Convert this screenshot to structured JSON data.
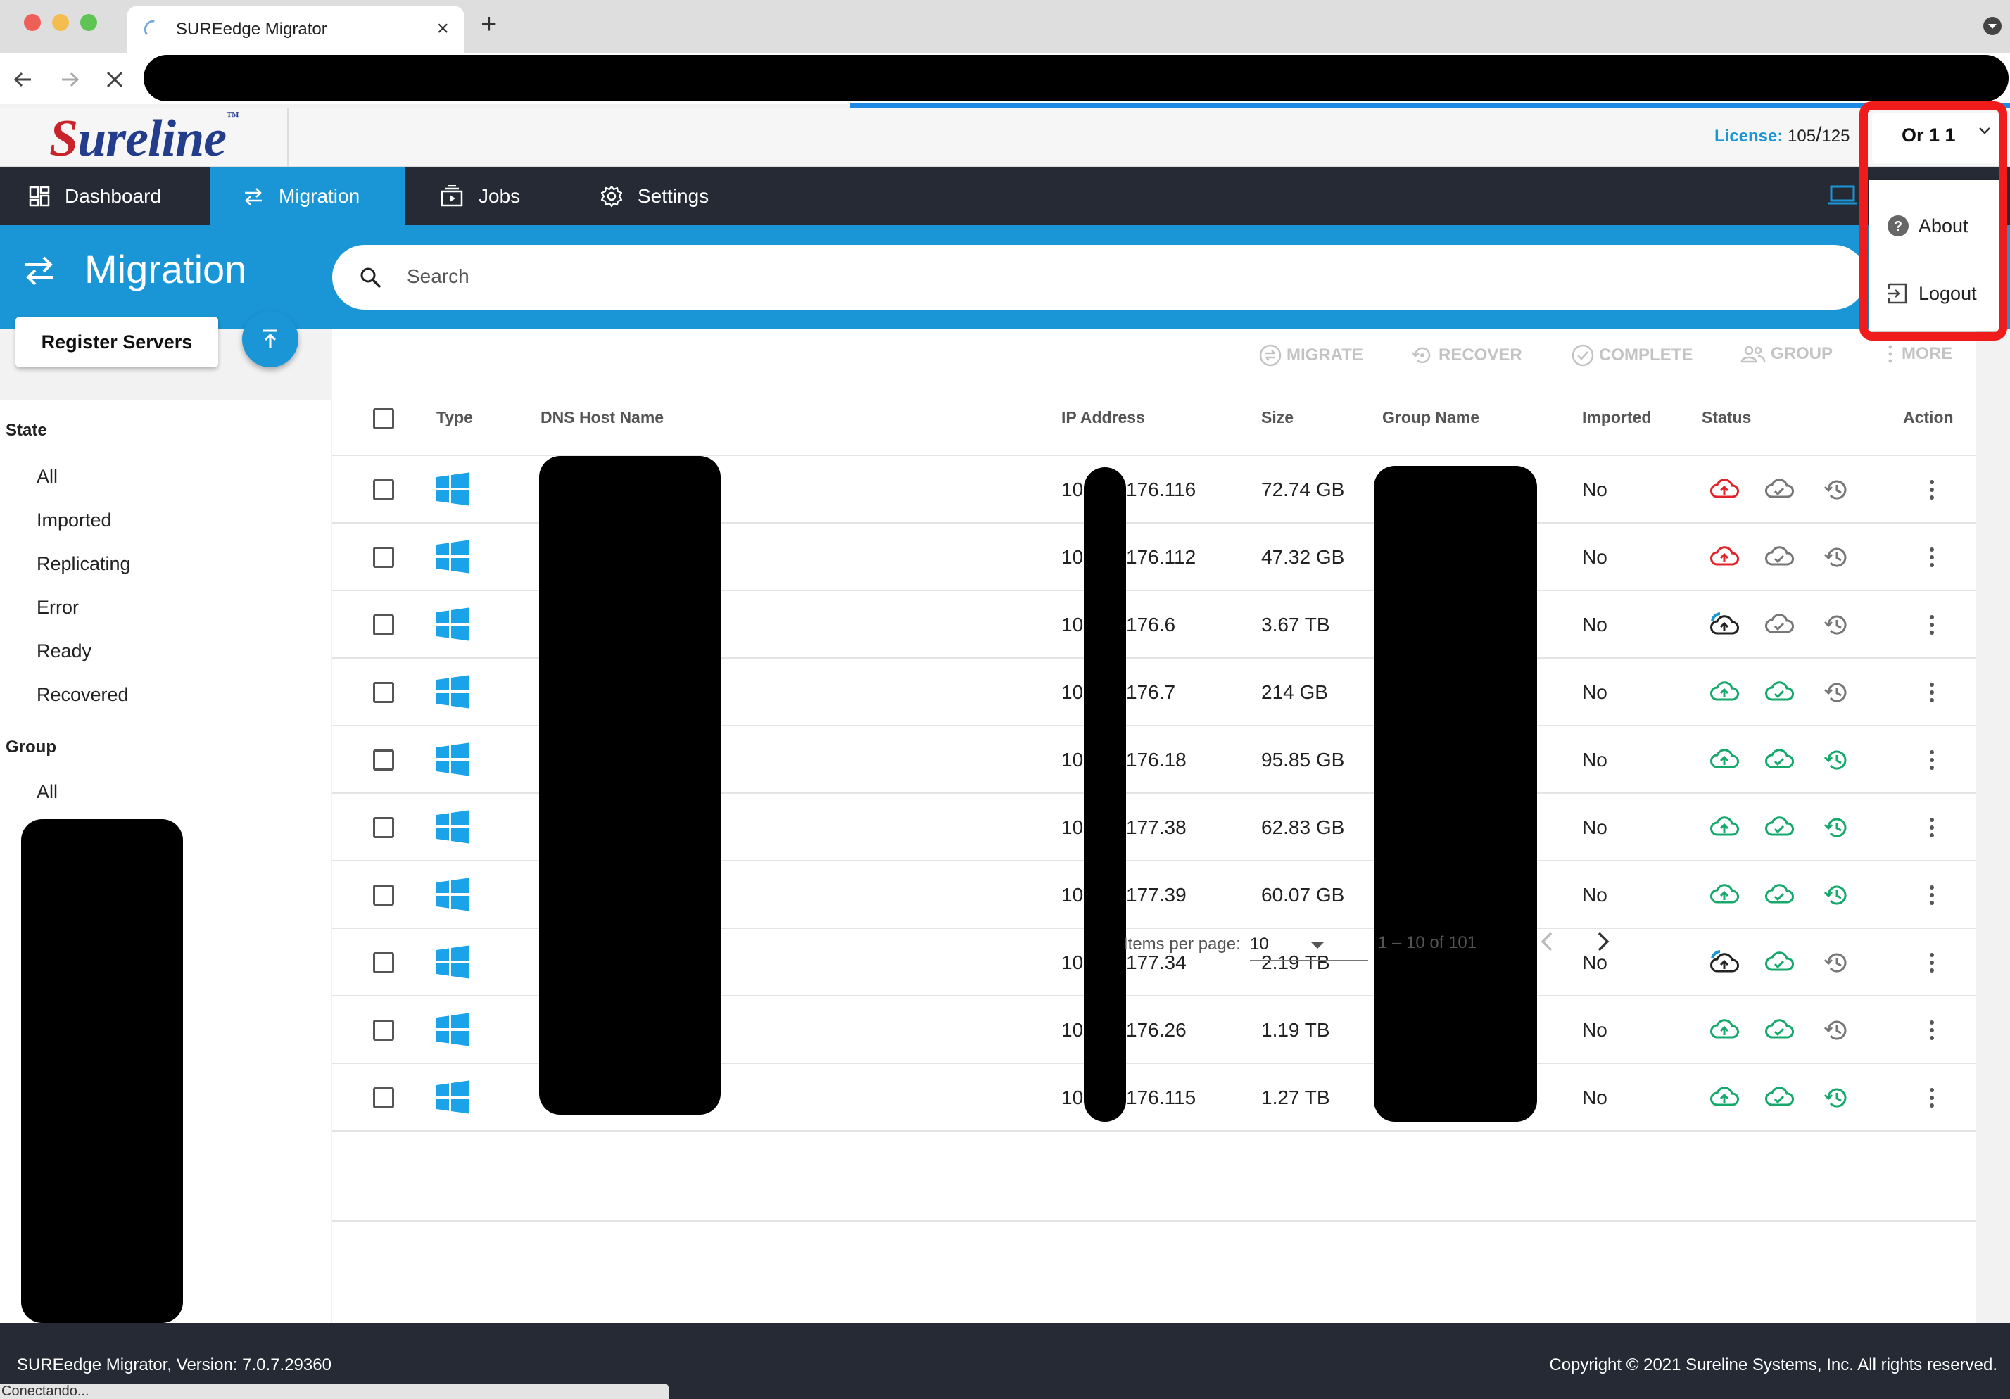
{
  "browser": {
    "tab_title": "SUREedge Migrator",
    "tab_close": "×",
    "new_tab": "+"
  },
  "header": {
    "logo_text": "ureline",
    "logo_s": "S",
    "logo_tm": "™",
    "license_label": "License:",
    "license_used": "105",
    "license_sep": "/",
    "license_total": "125",
    "user_name": "Or 1 1"
  },
  "nav": {
    "items": [
      {
        "label": "Dashboard",
        "icon": "dashboard-icon"
      },
      {
        "label": "Migration",
        "icon": "swap-icon"
      },
      {
        "label": "Jobs",
        "icon": "jobs-icon"
      },
      {
        "label": "Settings",
        "icon": "gear-icon"
      }
    ],
    "active": "Migration"
  },
  "page": {
    "title": "Migration",
    "search_placeholder": "Search",
    "register_button": "Register Servers"
  },
  "filters": {
    "state_heading": "State",
    "state_items": [
      "All",
      "Imported",
      "Replicating",
      "Error",
      "Ready",
      "Recovered"
    ],
    "group_heading": "Group",
    "group_items": [
      "All"
    ]
  },
  "actions": [
    "MIGRATE",
    "RECOVER",
    "COMPLETE",
    "GROUP",
    "MORE"
  ],
  "table": {
    "columns": [
      "Type",
      "DNS Host Name",
      "IP Address",
      "Size",
      "Group Name",
      "Imported",
      "Status",
      "Action"
    ],
    "rows": [
      {
        "ip_prefix": "10",
        "ip_suffix": "176.116",
        "size": "72.74 GB",
        "imported": "No",
        "status": [
          "upload-error",
          "cloud-gray",
          "history-gray"
        ]
      },
      {
        "ip_prefix": "10",
        "ip_suffix": "176.112",
        "size": "47.32 GB",
        "imported": "No",
        "status": [
          "upload-error",
          "cloud-gray",
          "history-gray"
        ]
      },
      {
        "ip_prefix": "10",
        "ip_suffix": "176.6",
        "size": "3.67 TB",
        "imported": "No",
        "status": [
          "upload-progress",
          "cloud-gray",
          "history-gray"
        ]
      },
      {
        "ip_prefix": "10",
        "ip_suffix": "176.7",
        "size": "214 GB",
        "imported": "No",
        "status": [
          "upload-ok",
          "cloud-ok",
          "history-gray"
        ]
      },
      {
        "ip_prefix": "10",
        "ip_suffix": "176.18",
        "size": "95.85 GB",
        "imported": "No",
        "status": [
          "upload-ok",
          "cloud-ok",
          "history-ok"
        ]
      },
      {
        "ip_prefix": "10",
        "ip_suffix": "177.38",
        "size": "62.83 GB",
        "imported": "No",
        "status": [
          "upload-ok",
          "cloud-ok",
          "history-ok"
        ]
      },
      {
        "ip_prefix": "10",
        "ip_suffix": "177.39",
        "size": "60.07 GB",
        "imported": "No",
        "status": [
          "upload-ok",
          "cloud-ok",
          "history-ok"
        ]
      },
      {
        "ip_prefix": "10",
        "ip_suffix": "177.34",
        "size": "2.19 TB",
        "imported": "No",
        "status": [
          "upload-progress",
          "cloud-ok",
          "history-gray"
        ]
      },
      {
        "ip_prefix": "10",
        "ip_suffix": "176.26",
        "size": "1.19 TB",
        "imported": "No",
        "status": [
          "upload-ok",
          "cloud-ok",
          "history-gray"
        ]
      },
      {
        "ip_prefix": "10",
        "ip_suffix": "176.115",
        "size": "1.27 TB",
        "imported": "No",
        "status": [
          "upload-ok",
          "cloud-ok",
          "history-ok"
        ]
      }
    ]
  },
  "paginator": {
    "label": "Items per page:",
    "page_size": "10",
    "range": "1 – 10 of 101"
  },
  "menu": {
    "items": [
      {
        "label": "About",
        "icon": "help-icon"
      },
      {
        "label": "Logout",
        "icon": "logout-icon"
      }
    ]
  },
  "footer": {
    "version": "SUREedge Migrator, Version: 7.0.7.29360",
    "copyright": "Copyright © 2021 Sureline Systems, Inc. All rights reserved."
  },
  "status_bar_text": "Conectando...",
  "colors": {
    "accent": "#1a96d6",
    "nav_bg": "#252a35",
    "status_ok": "#17a86b",
    "status_error": "#e0242a",
    "highlight": "#f01c1c"
  }
}
